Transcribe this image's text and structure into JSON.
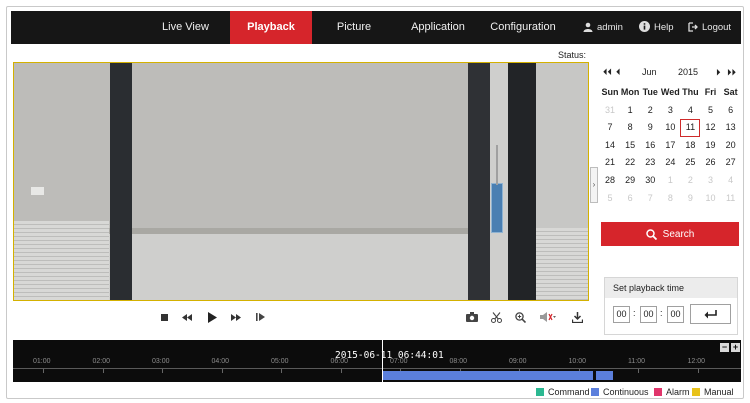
{
  "nav": {
    "tabs": [
      {
        "label": "Live View",
        "active": false
      },
      {
        "label": "Playback",
        "active": true
      },
      {
        "label": "Picture",
        "active": false
      },
      {
        "label": "Application",
        "active": false
      },
      {
        "label": "Configuration",
        "active": false
      }
    ],
    "user": "admin",
    "help": "Help",
    "logout": "Logout",
    "colors": {
      "bar": "#161616",
      "accent": "#d6252b"
    }
  },
  "status_label": "Status:",
  "calendar": {
    "month": "Jun",
    "year": "2015",
    "nav_icons": [
      "double-chevron-left-icon",
      "chevron-left-icon",
      "chevron-right-icon",
      "double-chevron-right-icon"
    ],
    "weekdays": [
      "Sun",
      "Mon",
      "Tue",
      "Wed",
      "Thu",
      "Fri",
      "Sat"
    ],
    "weeks": [
      [
        "31",
        "1",
        "2",
        "3",
        "4",
        "5",
        "6"
      ],
      [
        "7",
        "8",
        "9",
        "10",
        "11",
        "12",
        "13"
      ],
      [
        "14",
        "15",
        "16",
        "17",
        "18",
        "19",
        "20"
      ],
      [
        "21",
        "22",
        "23",
        "24",
        "25",
        "26",
        "27"
      ],
      [
        "28",
        "29",
        "30",
        "1",
        "2",
        "3",
        "4"
      ],
      [
        "5",
        "6",
        "7",
        "8",
        "9",
        "10",
        "11"
      ]
    ],
    "selected_day": "11"
  },
  "search_label": "Search",
  "playback_time": {
    "title": "Set playback time",
    "hh": "00",
    "mm": "00",
    "ss": "00"
  },
  "controls": {
    "left": [
      "stop-icon",
      "rewind-icon",
      "play-icon",
      "fast-forward-icon",
      "frame-step-icon"
    ],
    "right": [
      "camera-icon",
      "scissors-icon",
      "zoom-in-icon",
      "volume-icon",
      "download-icon"
    ]
  },
  "timeline": {
    "current_time": "2015-06-11 06:44:01",
    "ticks": [
      "01:00",
      "02:00",
      "03:00",
      "04:00",
      "05:00",
      "06:00",
      "07:00",
      "08:00",
      "09:00",
      "10:00",
      "11:00",
      "12:00"
    ],
    "zoom_out": "−",
    "zoom_in": "+",
    "recording": {
      "type": "Continuous",
      "start": "06:44",
      "end": "10:15",
      "gap_end": "10:20",
      "end2": "10:30"
    }
  },
  "legend": [
    {
      "label": "Command",
      "color": "#2bb891"
    },
    {
      "label": "Continuous",
      "color": "#5b7fdc"
    },
    {
      "label": "Alarm",
      "color": "#e0356b"
    },
    {
      "label": "Manual",
      "color": "#e8c21a"
    }
  ]
}
